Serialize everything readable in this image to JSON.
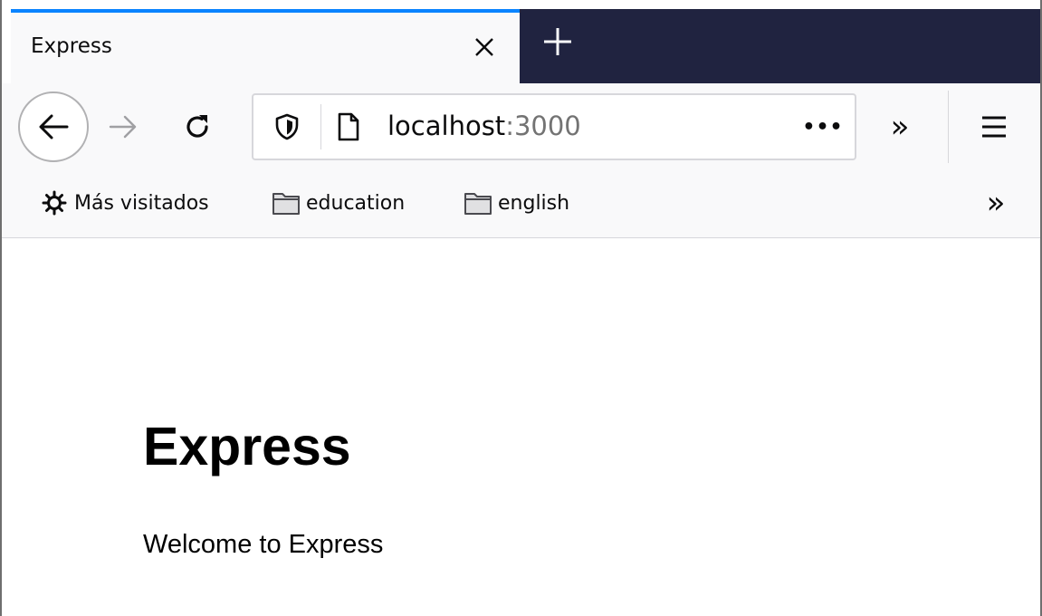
{
  "browser": {
    "tab": {
      "title": "Express",
      "close_icon": "close-icon",
      "accent_color": "#0a84ff"
    },
    "new_tab_icon": "plus-icon",
    "toolbar": {
      "back_icon": "arrow-left-icon",
      "forward_icon": "arrow-right-icon",
      "reload_icon": "reload-icon",
      "url": {
        "host": "localhost",
        "port": ":3000",
        "shield_icon": "shield-icon",
        "page_icon": "page-icon",
        "actions_label": "•••"
      },
      "overflow_label": "»",
      "menu_icon": "hamburger-menu-icon"
    },
    "bookmarks": {
      "items": [
        {
          "label": "Más visitados",
          "icon": "gear-icon"
        },
        {
          "label": "education",
          "icon": "folder-icon"
        },
        {
          "label": "english",
          "icon": "folder-icon"
        }
      ],
      "overflow_label": "»"
    }
  },
  "page": {
    "heading": "Express",
    "paragraph": "Welcome to Express"
  },
  "colors": {
    "tabstrip_dark": "#202340",
    "toolbar_bg": "#f9f9fa",
    "url_port": "#737373"
  }
}
